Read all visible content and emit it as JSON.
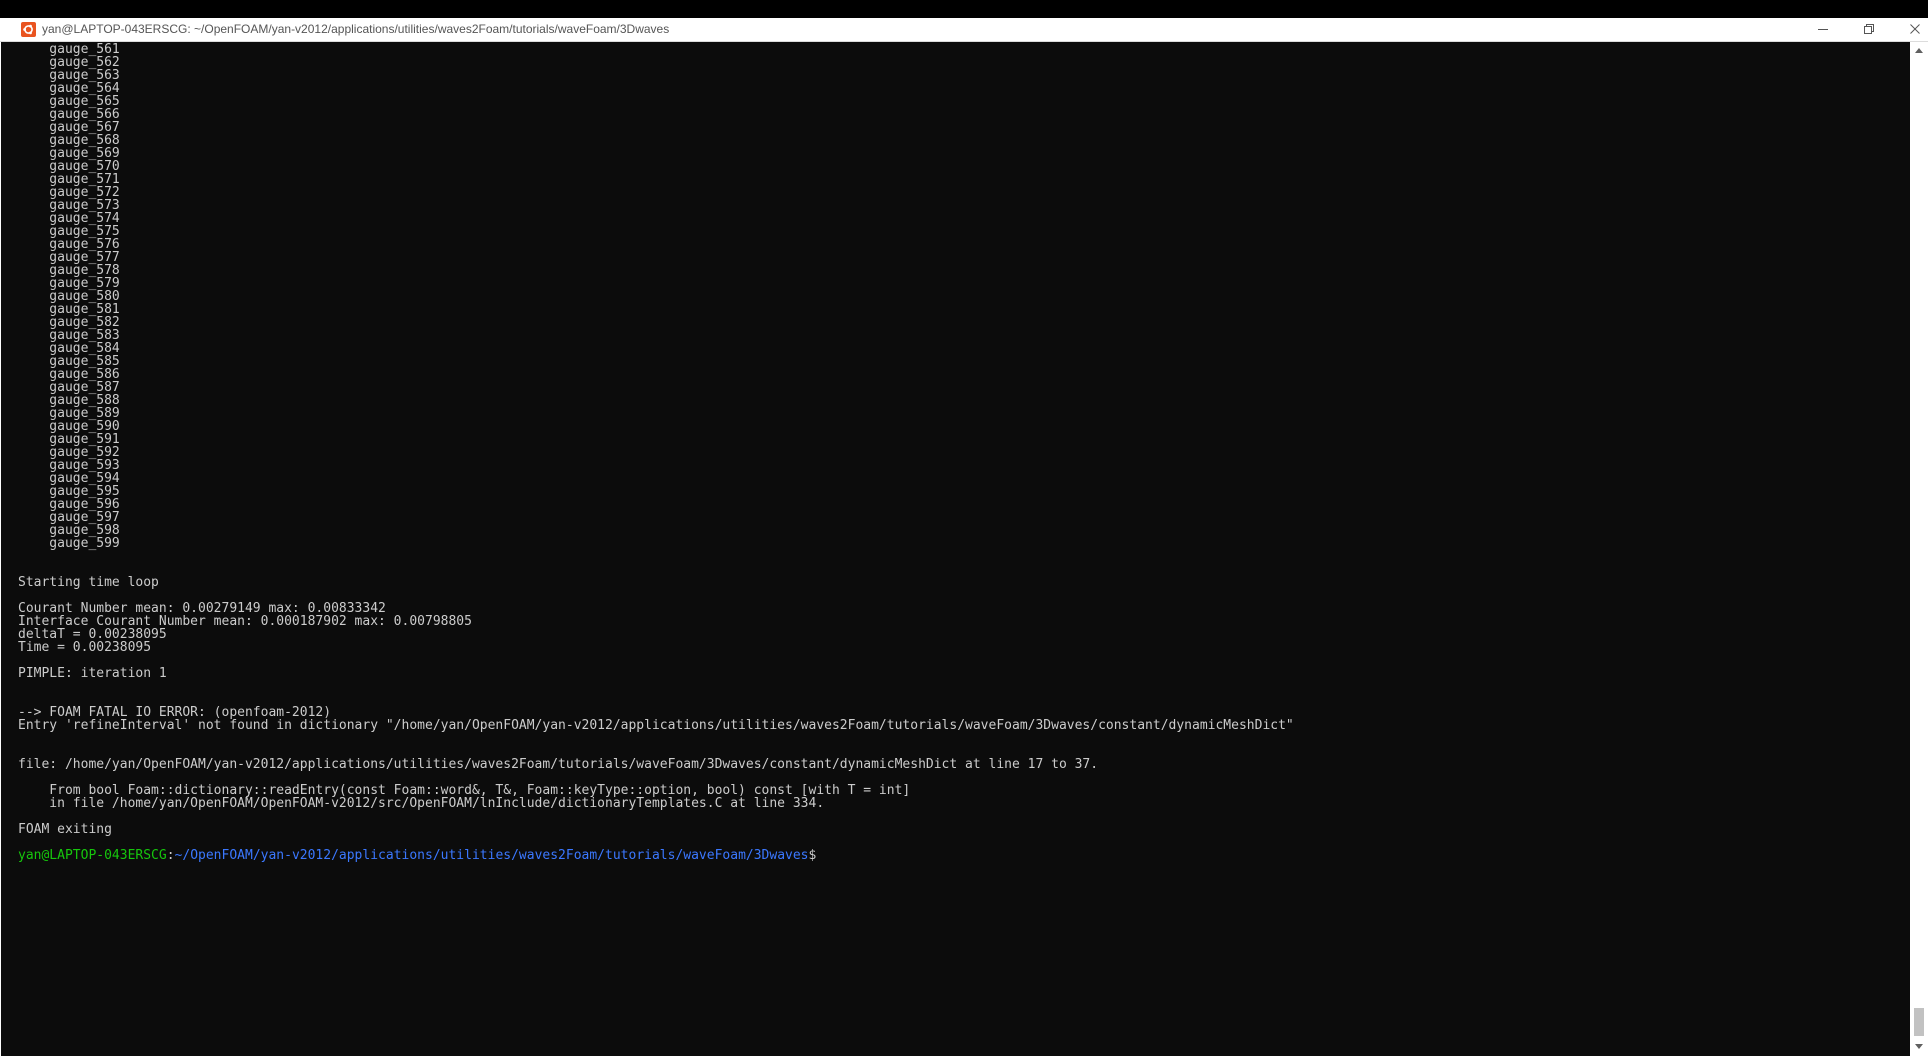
{
  "window": {
    "title": "yan@LAPTOP-043ERSCG: ~/OpenFOAM/yan-v2012/applications/utilities/waves2Foam/tutorials/waveFoam/3Dwaves",
    "icon": "ubuntu-icon",
    "controls": {
      "minimize": "minimize-icon",
      "maximize": "restore-icon",
      "close": "close-icon"
    },
    "accent": "#e95420"
  },
  "terminal": {
    "lines": [
      "    gauge_561",
      "    gauge_562",
      "    gauge_563",
      "    gauge_564",
      "    gauge_565",
      "    gauge_566",
      "    gauge_567",
      "    gauge_568",
      "    gauge_569",
      "    gauge_570",
      "    gauge_571",
      "    gauge_572",
      "    gauge_573",
      "    gauge_574",
      "    gauge_575",
      "    gauge_576",
      "    gauge_577",
      "    gauge_578",
      "    gauge_579",
      "    gauge_580",
      "    gauge_581",
      "    gauge_582",
      "    gauge_583",
      "    gauge_584",
      "    gauge_585",
      "    gauge_586",
      "    gauge_587",
      "    gauge_588",
      "    gauge_589",
      "    gauge_590",
      "    gauge_591",
      "    gauge_592",
      "    gauge_593",
      "    gauge_594",
      "    gauge_595",
      "    gauge_596",
      "    gauge_597",
      "    gauge_598",
      "    gauge_599",
      "",
      "",
      "Starting time loop",
      "",
      "Courant Number mean: 0.00279149 max: 0.00833342",
      "Interface Courant Number mean: 0.000187902 max: 0.00798805",
      "deltaT = 0.00238095",
      "Time = 0.00238095",
      "",
      "PIMPLE: iteration 1",
      "",
      "",
      "--> FOAM FATAL IO ERROR: (openfoam-2012)",
      "Entry 'refineInterval' not found in dictionary \"/home/yan/OpenFOAM/yan-v2012/applications/utilities/waves2Foam/tutorials/waveFoam/3Dwaves/constant/dynamicMeshDict\"",
      "",
      "",
      "file: /home/yan/OpenFOAM/yan-v2012/applications/utilities/waves2Foam/tutorials/waveFoam/3Dwaves/constant/dynamicMeshDict at line 17 to 37.",
      "",
      "    From bool Foam::dictionary::readEntry(const Foam::word&, T&, Foam::keyType::option, bool) const [with T = int]",
      "    in file /home/yan/OpenFOAM/OpenFOAM-v2012/src/OpenFOAM/lnInclude/dictionaryTemplates.C at line 334.",
      "",
      "FOAM exiting",
      ""
    ],
    "prompt": {
      "user_host": "yan@LAPTOP-043ERSCG",
      "colon": ":",
      "path": "~/OpenFOAM/yan-v2012/applications/utilities/waves2Foam/tutorials/waveFoam/3Dwaves",
      "symbol": "$"
    },
    "colors": {
      "background": "#0c0c0c",
      "foreground": "#cccccc",
      "prompt_user": "#16c60c",
      "prompt_path": "#3b78ff"
    }
  }
}
